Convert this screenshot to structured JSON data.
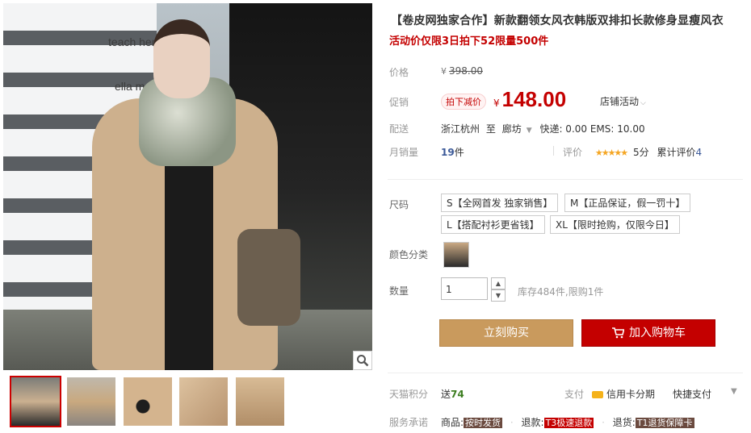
{
  "product": {
    "title": "【卷皮网独家合作】新款翻领女风衣韩版双排扣长款修身显瘦风衣",
    "subtitle": "活动价仅限3日拍下52限量500件"
  },
  "gallery": {
    "sign1": "teach her",
    "sign2": "ella m",
    "zoom_icon": "magnifier-icon"
  },
  "price": {
    "label": "价格",
    "currency": "¥",
    "original": "398.00"
  },
  "promo": {
    "label": "促销",
    "tag": "拍下减价",
    "currency": "¥",
    "value": "148.00",
    "shop_activity": "店铺活动"
  },
  "shipping": {
    "label": "配送",
    "from": "浙江杭州",
    "to_word": "至",
    "dest": "廊坊",
    "fees": "快递: 0.00 EMS: 10.00"
  },
  "sales": {
    "label": "月销量",
    "count": "19",
    "unit": "件",
    "review_label": "评价",
    "stars": "★★★★★",
    "score": "5分",
    "total_label": "累计评价",
    "total": "4"
  },
  "sku": {
    "size_label": "尺码",
    "sizes": [
      {
        "label": "S【全网首发 独家销售】"
      },
      {
        "label": "M【正品保证，假一罚十】"
      },
      {
        "label": "L【搭配衬衫更省钱】"
      },
      {
        "label": "XL【限时抢购，仅限今日】"
      }
    ],
    "color_label": "颜色分类"
  },
  "quantity": {
    "label": "数量",
    "value": "1",
    "stock": "库存484件,限购1件",
    "up": "▲",
    "down": "▼"
  },
  "actions": {
    "buy": "立刻购买",
    "cart": "加入购物车"
  },
  "points": {
    "label": "天猫积分",
    "prefix": "送",
    "value": "74"
  },
  "payment": {
    "label": "支付",
    "credit": "信用卡分期",
    "quick": "快捷支付"
  },
  "service": {
    "label": "服务承诺",
    "goods": "商品:",
    "goods_tag": "按时发货",
    "refund": "退款:",
    "refund_tag": "T3极速退款",
    "return": "退货:",
    "return_tag": "T1退货保障卡"
  }
}
